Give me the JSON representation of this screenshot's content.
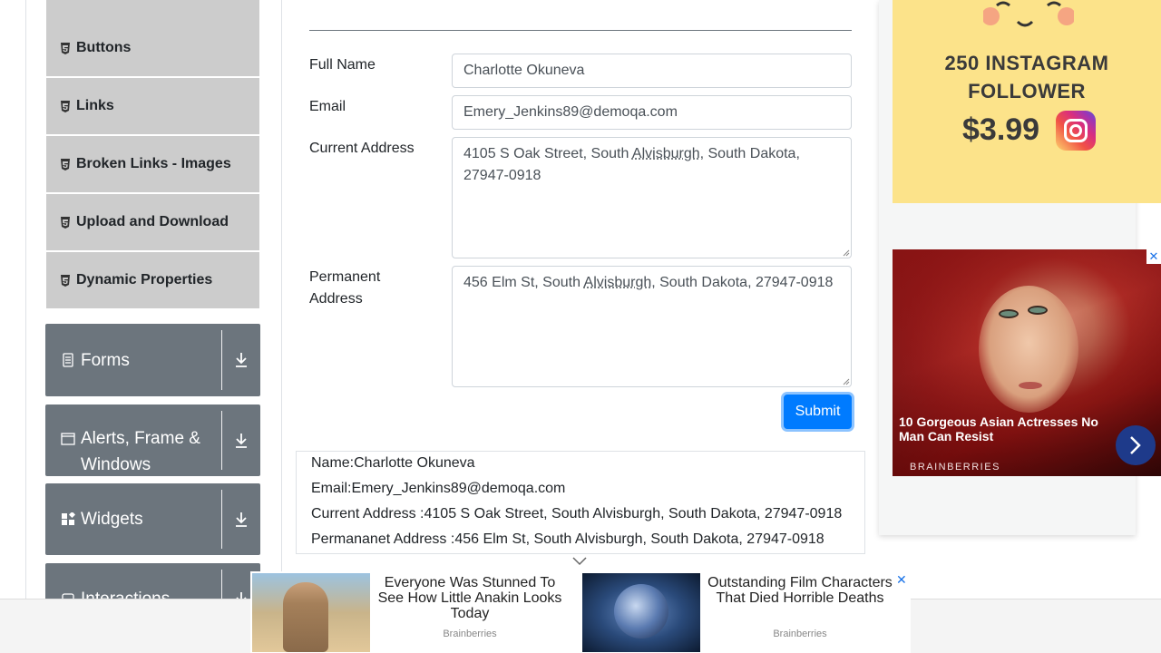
{
  "sidebar": {
    "elements_items": [
      {
        "label": "Buttons"
      },
      {
        "label": "Links"
      },
      {
        "label": "Broken Links - Images"
      },
      {
        "label": "Upload and Download"
      },
      {
        "label": "Dynamic Properties"
      }
    ],
    "groups": [
      {
        "label": "Forms"
      },
      {
        "label": "Alerts, Frame & Windows"
      },
      {
        "label": "Widgets"
      },
      {
        "label": "Interactions"
      }
    ]
  },
  "form": {
    "full_name_label": "Full Name",
    "full_name_value": "Charlotte Okuneva",
    "email_label": "Email",
    "email_value": "Emery_Jenkins89@demoqa.com",
    "current_address_label": "Current Address",
    "current_address_pre": "4105 S Oak Street, South ",
    "current_address_dotted": "Alvisburgh",
    "current_address_post": ", South Dakota, 27947-0918",
    "permanent_address_label": "Permanent Address",
    "permanent_address_pre": "456 Elm St, South ",
    "permanent_address_dotted": "Alvisburgh",
    "permanent_address_post": ", South Dakota, 27947-0918",
    "submit_label": "Submit"
  },
  "output": {
    "name": "Name:Charlotte Okuneva",
    "email": "Email:Emery_Jenkins89@demoqa.com",
    "current_address": "Current Address :4105 S Oak Street, South Alvisburgh, South Dakota, 27947-0918",
    "permanent_address": "Permananet Address :456 Elm St, South Alvisburgh, South Dakota, 27947-0918"
  },
  "ads": {
    "instagram": {
      "headline": "250 INSTAGRAM FOLLOWER",
      "price": "$3.99"
    },
    "photo": {
      "headline": "10 Gorgeous Asian Actresses No Man Can Resist",
      "brand": "BRAINBERRIES",
      "close": "✕"
    },
    "banner": {
      "left_title": "Everyone Was Stunned To See How Little Anakin Looks Today",
      "left_source": "Brainberries",
      "right_title": "Outstanding Film Characters That Died Horrible Deaths",
      "right_source": "Brainberries",
      "close": "✕"
    }
  },
  "colors": {
    "accent": "#007bff",
    "sidebar_group": "#6c757d",
    "sidebar_item": "#cccccc"
  }
}
